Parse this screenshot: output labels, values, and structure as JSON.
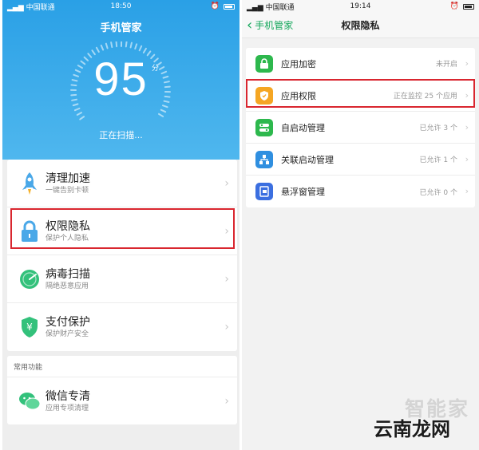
{
  "left": {
    "status": {
      "carrier": "中国联通",
      "time": "18:50"
    },
    "header_title": "手机管家",
    "score": "95",
    "score_unit": "分",
    "scan_status": "正在扫描...",
    "menu": [
      {
        "title": "清理加速",
        "subtitle": "一键告别卡顿",
        "icon": "rocket-icon"
      },
      {
        "title": "权限隐私",
        "subtitle": "保护个人隐私",
        "icon": "lock-icon"
      },
      {
        "title": "病毒扫描",
        "subtitle": "隔绝恶意应用",
        "icon": "radar-icon"
      },
      {
        "title": "支付保护",
        "subtitle": "保护财产安全",
        "icon": "yen-shield-icon"
      }
    ],
    "common_section_label": "常用功能",
    "common_items": [
      {
        "title": "微信专清",
        "subtitle": "应用专项清理",
        "icon": "wechat-icon"
      }
    ]
  },
  "right": {
    "status": {
      "carrier": "中国联通",
      "time": "19:14"
    },
    "back_label": "手机管家",
    "page_title": "权限隐私",
    "items": [
      {
        "label": "应用加密",
        "status": "未开启",
        "icon": "lock-icon",
        "color": "#2db84d"
      },
      {
        "label": "应用权限",
        "status": "正在监控 25 个应用",
        "icon": "shield-icon",
        "color": "#f5a623"
      },
      {
        "label": "自启动管理",
        "status": "已允许 3 个",
        "icon": "toggle-icon",
        "color": "#2db84d"
      },
      {
        "label": "关联启动管理",
        "status": "已允许 1 个",
        "icon": "network-icon",
        "color": "#2f8fe0"
      },
      {
        "label": "悬浮窗管理",
        "status": "已允许 0 个",
        "icon": "floating-window-icon",
        "color": "#3b6fe0"
      }
    ]
  },
  "watermark": {
    "top": "智能家",
    "main": "云南龙网"
  },
  "colors": {
    "hero_blue": "#2aa0e6",
    "highlight_red": "#d9262f",
    "accent_green": "#16a75c"
  }
}
